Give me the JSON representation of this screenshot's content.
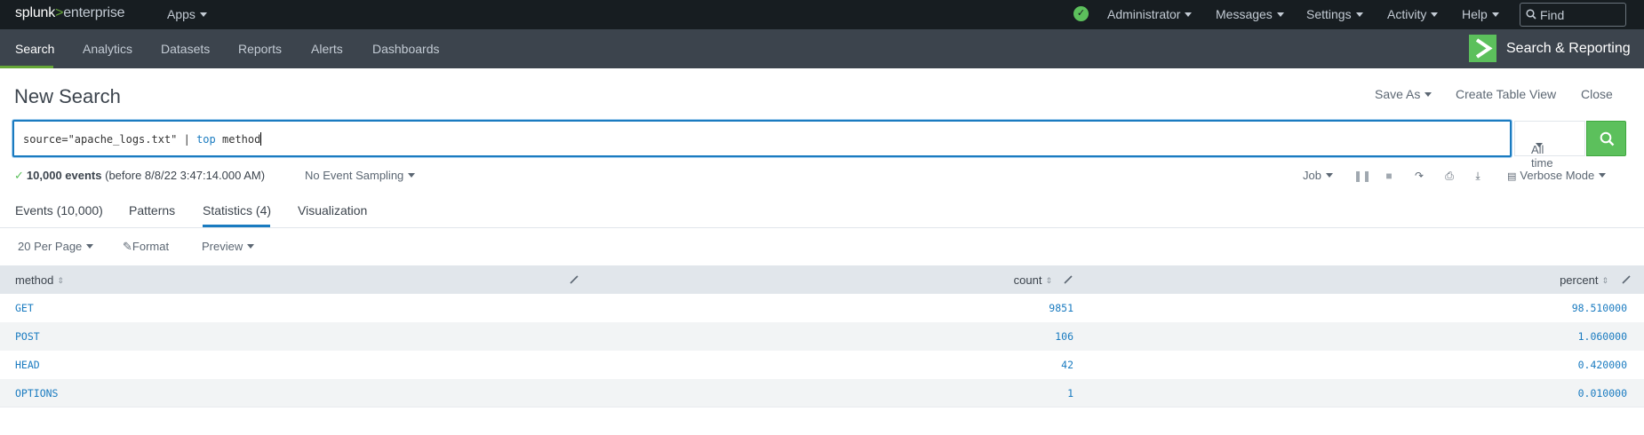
{
  "topbar": {
    "logo_brand": "splunk",
    "logo_gt": ">",
    "logo_product": "enterprise",
    "apps": "Apps",
    "status_icon": "check-circle-icon",
    "administrator": "Administrator",
    "messages": "Messages",
    "settings": "Settings",
    "activity": "Activity",
    "help": "Help",
    "find_placeholder": "Find"
  },
  "appbar": {
    "tabs": [
      "Search",
      "Analytics",
      "Datasets",
      "Reports",
      "Alerts",
      "Dashboards"
    ],
    "app_title": "Search & Reporting"
  },
  "header": {
    "title": "New Search",
    "save_as": "Save As",
    "create_table_view": "Create Table View",
    "close": "Close"
  },
  "search": {
    "query_prefix": "source=\"apache_logs.txt\" | ",
    "query_cmd": "top",
    "query_suffix": " method",
    "time_range": "All time"
  },
  "job": {
    "check": "✓",
    "events": "10,000 events",
    "before": "(before 8/8/22 3:47:14.000 AM)",
    "sampling": "No Event Sampling",
    "job_menu": "Job",
    "mode": "Verbose Mode"
  },
  "result_tabs": {
    "events": "Events (10,000)",
    "patterns": "Patterns",
    "statistics": "Statistics (4)",
    "visualization": "Visualization"
  },
  "table_toolbar": {
    "per_page": "20 Per Page",
    "format": "Format",
    "preview": "Preview"
  },
  "table": {
    "columns": [
      "method",
      "count",
      "percent"
    ],
    "rows": [
      {
        "method": "GET",
        "count": "9851",
        "percent": "98.510000"
      },
      {
        "method": "POST",
        "count": "106",
        "percent": "1.060000"
      },
      {
        "method": "HEAD",
        "count": "42",
        "percent": "0.420000"
      },
      {
        "method": "OPTIONS",
        "count": "1",
        "percent": "0.010000"
      }
    ]
  },
  "colors": {
    "topbar": "#171d21",
    "appbar": "#3c444d",
    "accent_green": "#5cc05c",
    "link_blue": "#1a7bc0"
  }
}
